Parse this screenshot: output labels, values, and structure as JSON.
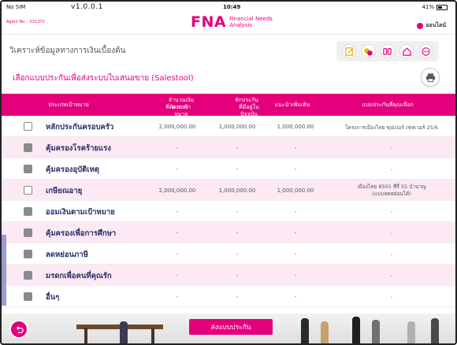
{
  "status_bar": {
    "carrier": "No SIM",
    "version": "v1.0.0.1",
    "time": "10:49",
    "battery": "41%"
  },
  "header": {
    "agent_no": "Agent No. : 031372",
    "logo": "FNA",
    "logo_sub_1": "Financial Needs",
    "logo_sub_2": "Analysis",
    "online_label": "ออนไลน์"
  },
  "page_title": "วิเคราะห์ข้อมูลทางการเงินเบื้องต้น",
  "select_link": "เลือกแบบประกันเพื่อส่งระบบใบเสนอขาย (Salestool)",
  "toolbar_icons": [
    "edit-icon",
    "coins-icon",
    "compare-icon",
    "home-icon",
    "more-icon"
  ],
  "table": {
    "headers": {
      "goal": "ประเภทเป้าหมาย",
      "target_line1": "จำนวนเงินตามเป้าหมาย",
      "target_line2": "ที่ต้องการ",
      "deduct_line1": "หักประกัน",
      "deduct_line2": "ที่มีอยู่ในปัจจุบัน",
      "recommend": "แนะนำเพิ่มเติม",
      "plan": "แบบประกันที่คุณเลือก"
    },
    "rows": [
      {
        "name": "หลักประกันครอบครัว",
        "checkbox": "enabled",
        "target": "2,000,000.00",
        "existing": "1,000,000.00",
        "recommend": "1,000,000.00",
        "plan": "โครงการเมืองไทย ซุปเปอร์ เซฟเวอร์ 25/6",
        "plan2": ""
      },
      {
        "name": "คุ้มครองโรคร้ายแรง",
        "checkbox": "disabled",
        "target": "-",
        "existing": "-",
        "recommend": "-",
        "plan": "-",
        "plan2": ""
      },
      {
        "name": "คุ้มครองอุบัติเหตุ",
        "checkbox": "disabled",
        "target": "-",
        "existing": "-",
        "recommend": "-",
        "plan": "-",
        "plan2": ""
      },
      {
        "name": "เกษียณอายุ",
        "checkbox": "enabled",
        "target": "2,000,000.00",
        "existing": "1,000,000.00",
        "recommend": "1,000,000.00",
        "plan": "เมืองไทย 8501 ซีรี่ 55 บำนาญ",
        "plan2": "(แบบลดหย่อนได้)"
      },
      {
        "name": "ออมเงินตามเป้าหมาย",
        "checkbox": "disabled",
        "target": "-",
        "existing": "-",
        "recommend": "-",
        "plan": "-",
        "plan2": ""
      },
      {
        "name": "คุ้มครองเพื่อการศึกษา",
        "checkbox": "disabled",
        "target": "-",
        "existing": "-",
        "recommend": "-",
        "plan": "-",
        "plan2": ""
      },
      {
        "name": "ลดหย่อนภาษี",
        "checkbox": "disabled",
        "target": "-",
        "existing": "-",
        "recommend": "-",
        "plan": "-",
        "plan2": ""
      },
      {
        "name": "มรดกเพื่อคนที่คุณรัก",
        "checkbox": "disabled",
        "target": "-",
        "existing": "-",
        "recommend": "-",
        "plan": "-",
        "plan2": ""
      },
      {
        "name": "อื่นๆ",
        "checkbox": "disabled",
        "target": "-",
        "existing": "-",
        "recommend": "-",
        "plan": "-",
        "plan2": ""
      }
    ]
  },
  "buttons": {
    "submit": "ส่งแบบประกัน",
    "back_icon": "back-arrow-icon"
  },
  "colors": {
    "brand": "#e4007c",
    "row_alt": "#fce9f3",
    "name_text": "#2b2f6b"
  }
}
